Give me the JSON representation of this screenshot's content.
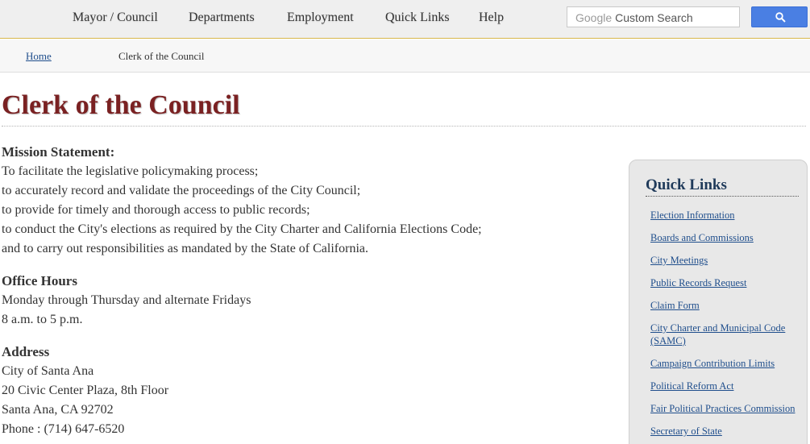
{
  "nav": {
    "items": [
      {
        "label": "Mayor / Council"
      },
      {
        "label": "Departments"
      },
      {
        "label": "Employment"
      },
      {
        "label": "Quick Links"
      },
      {
        "label": "Help"
      }
    ]
  },
  "search": {
    "brand": "Google",
    "placeholder": "Custom Search",
    "icon": "search-icon"
  },
  "breadcrumb": {
    "home": "Home",
    "current": "Clerk of the Council"
  },
  "main": {
    "title": "Clerk of the Council",
    "mission": {
      "heading": "Mission Statement:",
      "lines": [
        "To facilitate the legislative policymaking process;",
        "to accurately record and validate the proceedings of the City Council;",
        "to provide for timely and thorough access to public records;",
        "to conduct the City's elections as required by the City Charter and California Elections Code;",
        "and to carry out responsibilities as mandated by the State of California."
      ]
    },
    "hours": {
      "heading": "Office Hours",
      "lines": [
        "Monday through Thursday and alternate Fridays",
        "8 a.m. to 5 p.m."
      ]
    },
    "address": {
      "heading": "Address",
      "lines": [
        "City of Santa Ana",
        "20 Civic Center Plaza, 8th Floor",
        "Santa Ana, CA 92702",
        "Phone : (714) 647-6520"
      ]
    }
  },
  "quick_links": {
    "heading": "Quick Links",
    "items": [
      "Election Information",
      "Boards and Commissions",
      "City Meetings",
      "Public Records Request",
      "Claim Form",
      "City Charter and Municipal Code (SAMC)",
      "Campaign Contribution Limits",
      "Political Reform Act",
      "Fair Political Practices Commission",
      "Secretary of State"
    ]
  },
  "colors": {
    "title": "#7a2122",
    "link": "#1f4e8c",
    "search_button": "#4a7fe3",
    "nav_border": "#d7b74c"
  }
}
